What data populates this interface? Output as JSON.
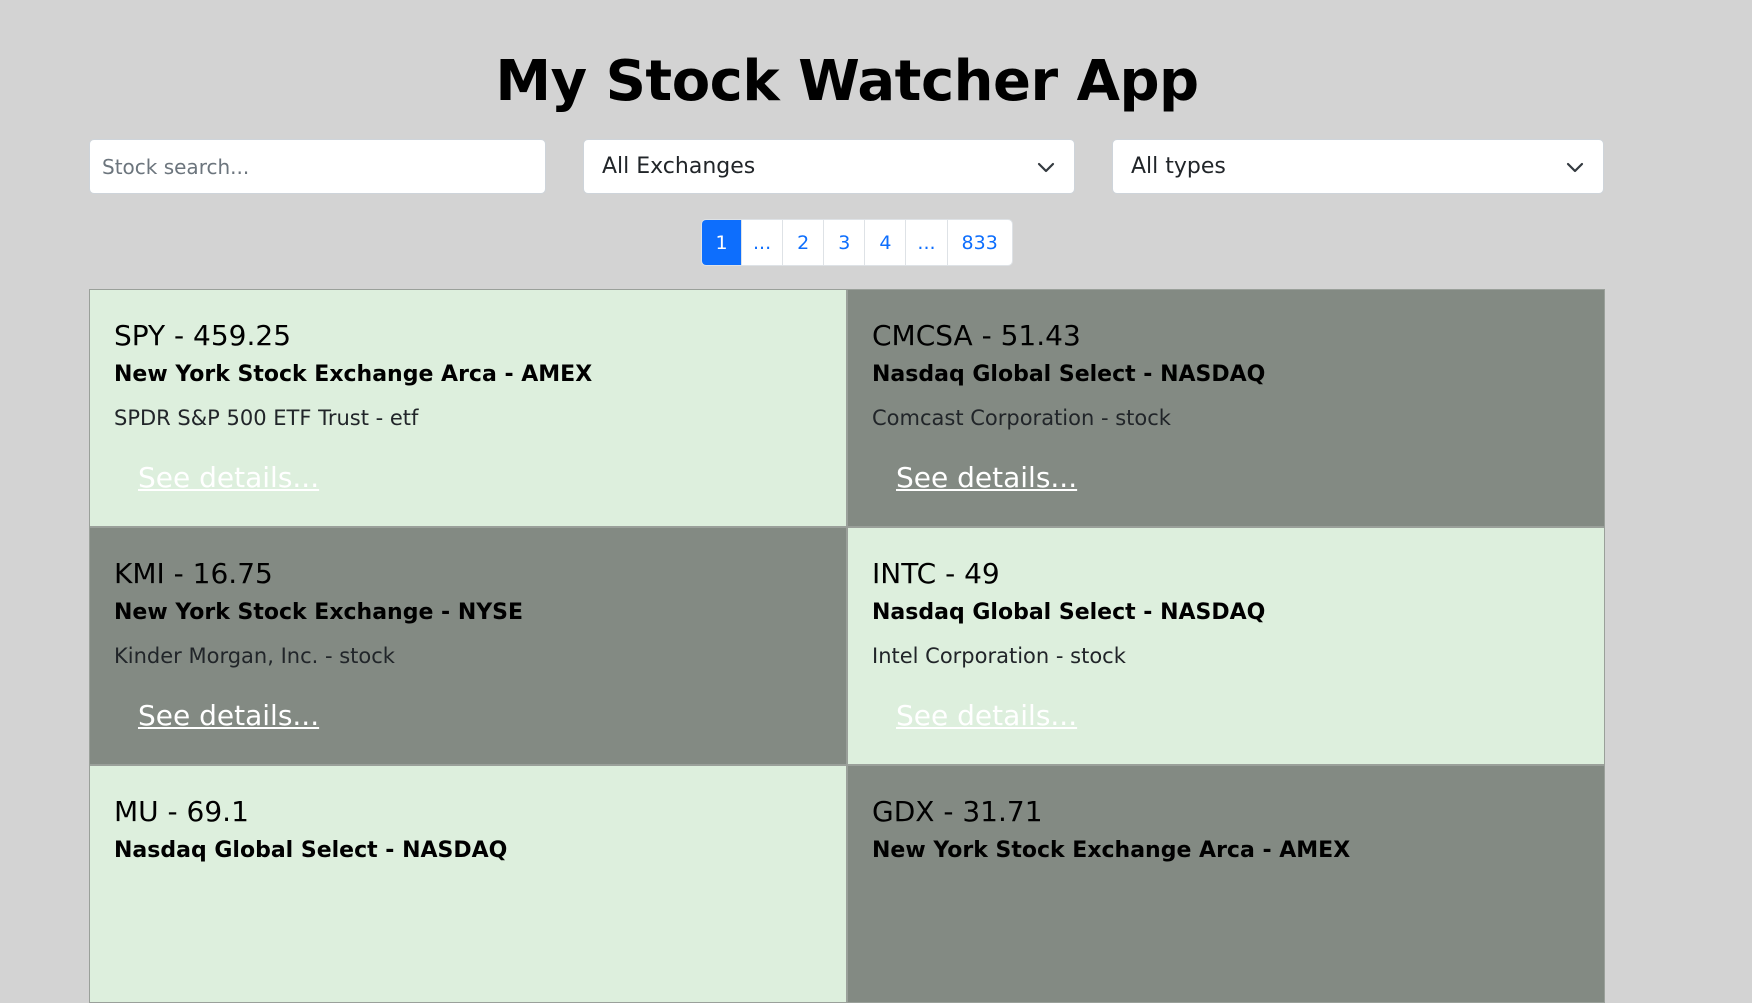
{
  "header": {
    "title": "My Stock Watcher App"
  },
  "filters": {
    "search_placeholder": "Stock search...",
    "exchange_value": "All Exchanges",
    "type_value": "All types"
  },
  "pagination": {
    "pages": [
      "1",
      "...",
      "2",
      "3",
      "4",
      "...",
      "833"
    ],
    "active": "1"
  },
  "stocks": [
    {
      "title": "SPY - 459.25",
      "exchange": "New York Stock Exchange Arca - AMEX",
      "description": "SPDR S&P 500 ETF Trust - etf",
      "link": "See details...",
      "theme": "light"
    },
    {
      "title": "CMCSA - 51.43",
      "exchange": "Nasdaq Global Select - NASDAQ",
      "description": "Comcast Corporation - stock",
      "link": "See details...",
      "theme": "dark"
    },
    {
      "title": "KMI - 16.75",
      "exchange": "New York Stock Exchange - NYSE",
      "description": "Kinder Morgan, Inc. - stock",
      "link": "See details...",
      "theme": "dark"
    },
    {
      "title": "INTC - 49",
      "exchange": "Nasdaq Global Select - NASDAQ",
      "description": "Intel Corporation - stock",
      "link": "See details...",
      "theme": "light"
    },
    {
      "title": "MU - 69.1",
      "exchange": "Nasdaq Global Select - NASDAQ",
      "description": "",
      "link": "",
      "theme": "light"
    },
    {
      "title": "GDX - 31.71",
      "exchange": "New York Stock Exchange Arca - AMEX",
      "description": "",
      "link": "",
      "theme": "dark"
    }
  ],
  "colors": {
    "background": "#d3d3d3",
    "card_light": "#ddefdd",
    "card_dark": "#838a83",
    "accent": "#0d6efd"
  }
}
